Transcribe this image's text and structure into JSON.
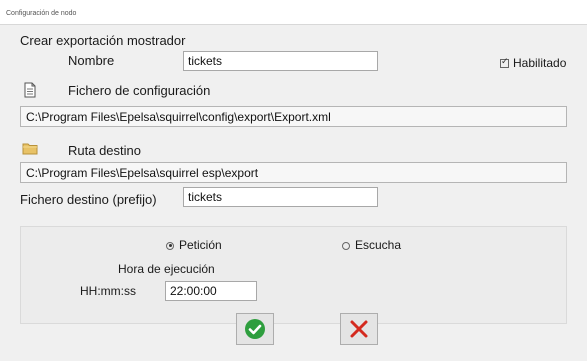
{
  "window": {
    "title": "Configuración de nodo"
  },
  "form": {
    "heading": "Crear exportación mostrador",
    "name_label": "Nombre",
    "name_value": "tickets",
    "enabled_label": "Habilitado",
    "enabled": true,
    "config_label": "Fichero de configuración",
    "config_path": "C:\\Program Files\\Epelsa\\squirrel\\config\\export\\Export.xml",
    "dest_label": "Ruta destino",
    "dest_path": "C:\\Program Files\\Epelsa\\squirrel esp\\export",
    "prefix_label": "Fichero destino (prefijo)",
    "prefix_value": "tickets"
  },
  "schedule": {
    "option_request": "Petición",
    "option_listen": "Escucha",
    "selected": "Petición",
    "time_heading": "Hora de ejecución",
    "time_label": "HH:mm:ss",
    "time_value": "22:00:00"
  },
  "icons": {
    "config": "document-icon",
    "dest": "folder-icon",
    "ok": "checkmark-icon",
    "cancel": "cross-icon"
  },
  "colors": {
    "ok": "#2e9e3e",
    "cancel": "#d42a1f",
    "folder": "#e8c266"
  }
}
